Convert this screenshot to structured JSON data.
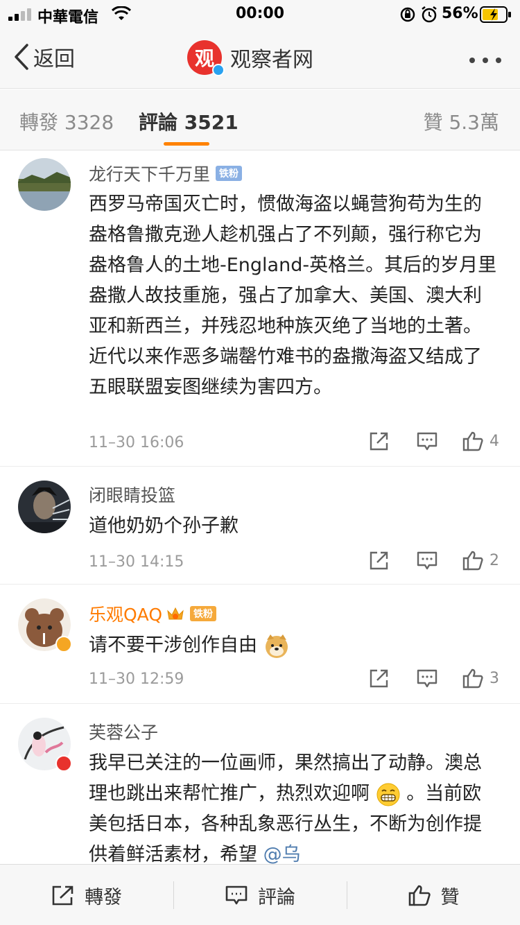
{
  "status_bar": {
    "carrier": "中華電信",
    "time": "00:00",
    "battery_pct": "56%"
  },
  "nav": {
    "back_label": "返回",
    "logo_char": "观",
    "title": "观察者网"
  },
  "tabs": {
    "repost": "轉發 3328",
    "comments": "評論 3521",
    "likes": "贊 5.3萬"
  },
  "comments": [
    {
      "name": "龙行天下千万里",
      "badge": "铁粉",
      "text": "西罗马帝国灭亡时，惯做海盗以蝇营狗苟为生的盎格鲁撒克逊人趁机强占了不列颠，强行称它为盎格鲁人的土地-England-英格兰。其后的岁月里盎撒人故技重施，强占了加拿大、美国、澳大利亚和新西兰，并残忍地种族灭绝了当地的土著。近代以来作恶多端罄竹难书的盎撒海盗又结成了五眼联盟妄图继续为害四方。",
      "time": "11–30 16:06",
      "likes": "4"
    },
    {
      "name": "闭眼睛投篮",
      "text": "道他奶奶个孙子歉",
      "time": "11–30 14:15",
      "likes": "2"
    },
    {
      "name": "乐观QAQ",
      "badge": "铁粉",
      "text": "请不要干涉创作自由",
      "time": "11–30 12:59",
      "likes": "3"
    },
    {
      "name": "芙蓉公子",
      "text_a": "我早已关注的一位画师，果然搞出了动静。澳总理也跳出来帮忙推广，热烈欢迎啊",
      "text_b": "。当前欧美包括日本，各种乱象恶行丛生，不断为创作提供着鲜活素材，希望",
      "mention": "@乌"
    }
  ],
  "toolbar": {
    "repost": "轉發",
    "comment": "評論",
    "like": "贊"
  },
  "colors": {
    "accent": "#ff8200",
    "vip_name": "#ff7b00",
    "link": "#507daf"
  }
}
